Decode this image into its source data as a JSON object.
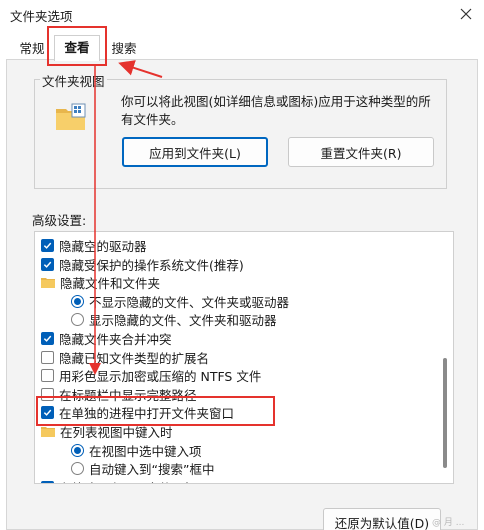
{
  "window": {
    "title": "文件夹选项"
  },
  "tabs": [
    {
      "label": "常规"
    },
    {
      "label": "查看"
    },
    {
      "label": "搜索"
    }
  ],
  "folder_views": {
    "group_label": "文件夹视图",
    "description": "你可以将此视图(如详细信息或图标)应用于这种类型的所有文件夹。",
    "apply_button": "应用到文件夹(L)",
    "reset_button": "重置文件夹(R)"
  },
  "advanced": {
    "label": "高级设置:",
    "items": [
      {
        "type": "checkbox",
        "checked": true,
        "label": "隐藏空的驱动器"
      },
      {
        "type": "checkbox",
        "checked": true,
        "label": "隐藏受保护的操作系统文件(推荐)"
      },
      {
        "type": "folder",
        "label": "隐藏文件和文件夹"
      },
      {
        "type": "radio",
        "checked": true,
        "label": "不显示隐藏的文件、文件夹或驱动器"
      },
      {
        "type": "radio",
        "checked": false,
        "label": "显示隐藏的文件、文件夹和驱动器"
      },
      {
        "type": "checkbox",
        "checked": true,
        "label": "隐藏文件夹合并冲突"
      },
      {
        "type": "checkbox",
        "checked": false,
        "label": "隐藏已知文件类型的扩展名"
      },
      {
        "type": "checkbox",
        "checked": false,
        "label": "用彩色显示加密或压缩的 NTFS 文件"
      },
      {
        "type": "checkbox",
        "checked": false,
        "label": "在标题栏中显示完整路径"
      },
      {
        "type": "checkbox",
        "checked": true,
        "label": "在单独的进程中打开文件夹窗口"
      },
      {
        "type": "folder",
        "label": "在列表视图中键入时"
      },
      {
        "type": "radio",
        "checked": true,
        "label": "在视图中选中键入项"
      },
      {
        "type": "radio",
        "checked": false,
        "label": "自动键入到“搜索”框中"
      },
      {
        "type": "checkbox",
        "checked": true,
        "label": "在缩略图上显示文件图标"
      }
    ]
  },
  "restore_button": "还原为默认值(D)",
  "watermark": "@ 月 ...",
  "colors": {
    "accent": "#005fb8",
    "annotation": "#e5322d"
  }
}
